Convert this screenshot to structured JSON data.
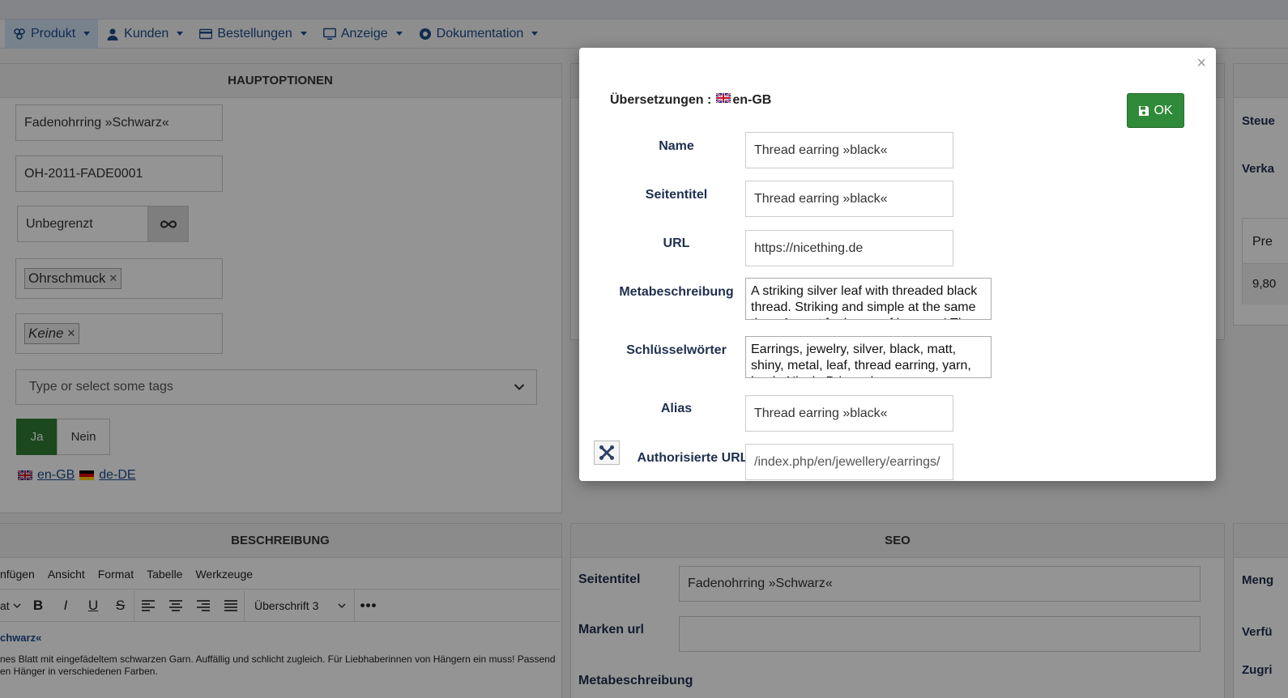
{
  "menu": {
    "items": [
      {
        "label": "Produkt",
        "icon": "cubes-icon"
      },
      {
        "label": "Kunden",
        "icon": "user-icon"
      },
      {
        "label": "Bestellungen",
        "icon": "credit-card-icon"
      },
      {
        "label": "Anzeige",
        "icon": "monitor-icon"
      },
      {
        "label": "Dokumentation",
        "icon": "lifebuoy-icon"
      }
    ]
  },
  "main_options": {
    "title": "HAUPTOPTIONEN",
    "product_name": "Fadenohrring »Schwarz«",
    "sku": "OH-2011-FADE0001",
    "stock": "Unbegrenzt",
    "category_tag": "Ohrschmuck",
    "manufacturer_tag": "Keine",
    "tags_placeholder": "Type or select some tags",
    "yes_label": "Ja",
    "no_label": "Nein",
    "lang_en": "en-GB",
    "lang_de": "de-DE"
  },
  "description": {
    "title": "BESCHREIBUNG",
    "menu_items": [
      "nfügen",
      "Ansicht",
      "Format",
      "Tabelle",
      "Werkzeuge"
    ],
    "format_prefix": "at",
    "heading_select": "Überschrift 3",
    "content_heading": "chwarz«",
    "content_line1": "nes Blatt mit eingefädeltem schwarzen Garn. Auffällig und schlicht zugleich. Für Liebhaberinnen von Hängern ein muss! Passend",
    "content_line2": "en Hänger in verschiedenen Farben."
  },
  "seo": {
    "title": "SEO",
    "page_title_label": "Seitentitel",
    "page_title_value": "Fadenohrring »Schwarz«",
    "brand_url_label": "Marken url",
    "brand_url_value": "",
    "meta_label": "Metabeschreibung"
  },
  "right_column": {
    "labels": [
      "Steue",
      "Verka",
      "Pre",
      "9,80",
      "Meng",
      "Verfü",
      "Zugri"
    ]
  },
  "modal": {
    "title": "Übersetzungen :",
    "lang": "en-GB",
    "ok_label": "OK",
    "close": "×",
    "rows": {
      "name_label": "Name",
      "name_value": "Thread earring »black«",
      "page_title_label": "Seitentitel",
      "page_title_value": "Thread earring »black«",
      "url_label": "URL",
      "url_value": "https://nicething.de",
      "meta_label": "Metabeschreibung",
      "meta_value": "A striking silver leaf with threaded black thread. Striking and simple at the same time. A must for lovers of hangers! The",
      "keywords_label": "Schlüsselwörter",
      "keywords_value": "Earrings, jewelry, silver, black, matt, shiny, metal, leaf, thread earring, yarn, hook, Nicola Prigge, hangers",
      "alias_label": "Alias",
      "alias_value": "Thread earring »black«",
      "auth_url_label": "Authorisierte URL",
      "auth_url_value": "/index.php/en/jewellery/earrings/"
    }
  },
  "colors": {
    "accent": "#1d4b88",
    "ok_green": "#2f8a39",
    "yes_green": "#2f7d32"
  }
}
